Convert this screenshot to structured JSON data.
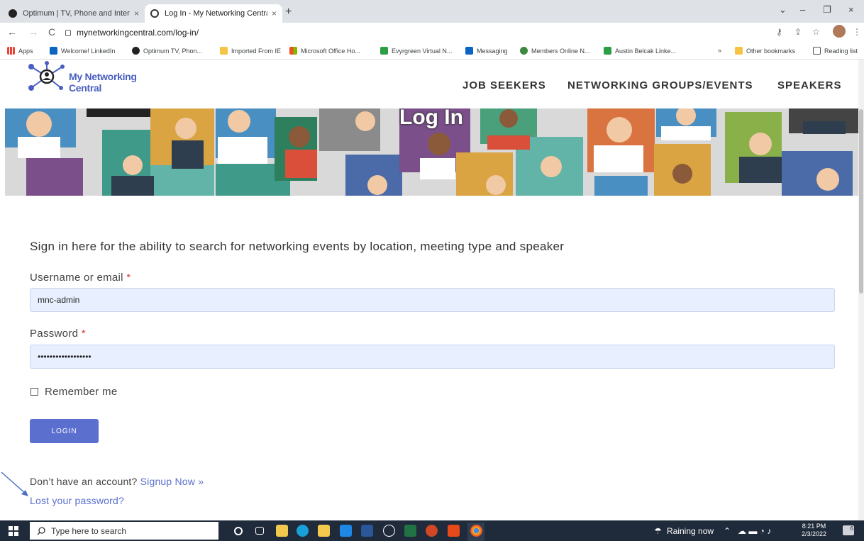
{
  "browser": {
    "tabs": [
      {
        "title": "Optimum | TV, Phone and Intern",
        "close": "×"
      },
      {
        "title": "Log In - My Networking Central",
        "close": "×"
      }
    ],
    "new_tab": "+",
    "window_controls": {
      "dropdown": "⌄",
      "minimize": "–",
      "maximize": "❐",
      "close": "×"
    },
    "nav": {
      "back": "←",
      "forward": "→",
      "reload": "C"
    },
    "url": "mynetworkingcentral.com/log-in/",
    "toolbar_icons": {
      "key": "⚷",
      "share": "⇪",
      "star": "☆",
      "menu": "⋮"
    },
    "bookmarks": [
      {
        "label": "Apps",
        "color": "#ea4335"
      },
      {
        "label": "Welcome! LinkedIn",
        "color": "#0a66c2"
      },
      {
        "label": "Optimum TV, Phon...",
        "color": "#222222"
      },
      {
        "label": "Imported From IE",
        "color": "#f6c343"
      },
      {
        "label": "Microsoft Office Ho...",
        "color": "#f25022"
      },
      {
        "label": "Evyrgreen Virtual N...",
        "color": "#2e9e44"
      },
      {
        "label": "Messaging",
        "color": "#0a66c2"
      },
      {
        "label": "Members Online N...",
        "color": "#3b8a3e"
      },
      {
        "label": "Austin Belcak Linke...",
        "color": "#2e9e44"
      }
    ],
    "bookmarks_overflow": "»",
    "other_bookmarks": "Other bookmarks",
    "reading_list": "Reading list"
  },
  "site": {
    "logo_text": "My Networking Central",
    "nav": [
      "JOB SEEKERS",
      "NETWORKING GROUPS/EVENTS",
      "SPEAKERS"
    ],
    "hero_title": "Log In"
  },
  "form": {
    "intro": "Sign in here for the ability to search for networking events by location, meeting type and speaker",
    "username_label": "Username or email",
    "username_value": "mnc-admin",
    "password_label": "Password",
    "password_value": "••••••••••••••••••",
    "required_mark": "*",
    "remember_label": "Remember me",
    "login_button": "LOGIN",
    "no_account": "Don’t have an account?",
    "signup_link": "Signup Now »",
    "lost_password": "Lost your password?"
  },
  "taskbar": {
    "search_placeholder": "Type here to search",
    "weather": "Raining now",
    "time": "8:21 PM",
    "date": "2/3/2022",
    "notifications": "6",
    "apps": [
      {
        "name": "cortana",
        "color": "#1f2a3a"
      },
      {
        "name": "task-view",
        "color": "#1f2a3a"
      },
      {
        "name": "file-explorer",
        "color": "#f2c94c"
      },
      {
        "name": "edge",
        "color": "#1aa0d8"
      },
      {
        "name": "store",
        "color": "#f2c94c"
      },
      {
        "name": "mail",
        "color": "#1e88e5"
      },
      {
        "name": "word",
        "color": "#2b579a"
      },
      {
        "name": "dell",
        "color": "#4a4f57"
      },
      {
        "name": "excel",
        "color": "#217346"
      },
      {
        "name": "powerpoint",
        "color": "#d24726"
      },
      {
        "name": "office",
        "color": "#e64a19"
      },
      {
        "name": "chrome",
        "color": "#fbbc05"
      }
    ]
  },
  "colors": {
    "accent": "#5b6fcf",
    "required": "#d4453b",
    "input_bg": "#e8efff"
  }
}
